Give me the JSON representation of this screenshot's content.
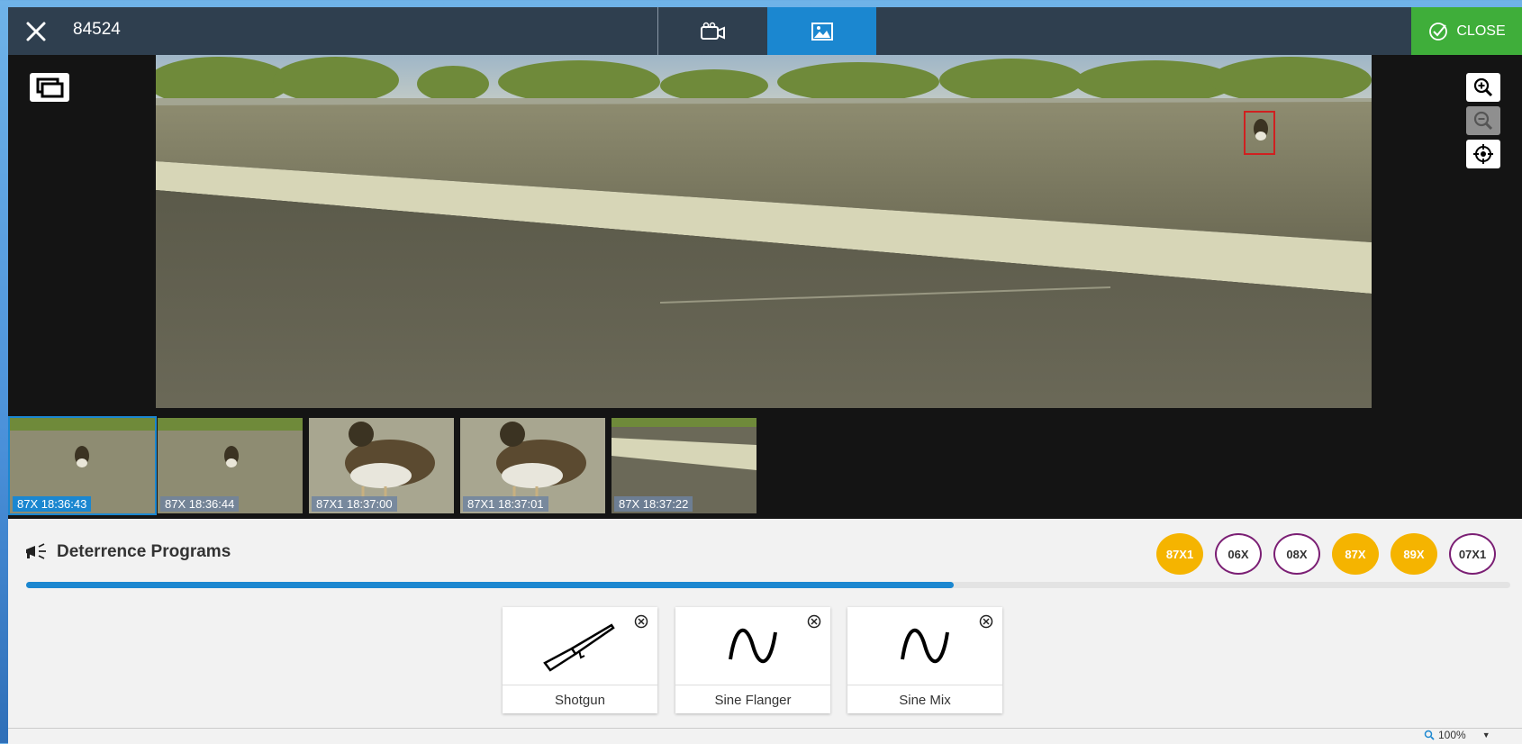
{
  "header": {
    "record_id": "84524",
    "tabs": [
      {
        "name": "video",
        "icon": "video-camera-icon",
        "active": false
      },
      {
        "name": "image",
        "icon": "image-icon",
        "active": true
      }
    ],
    "close_label": "CLOSE"
  },
  "viewer": {
    "tools": [
      "zoom-in-icon",
      "zoom-out-icon",
      "target-icon"
    ],
    "zoom_out_disabled": true
  },
  "thumbnails": [
    {
      "label": "87X 18:36:43",
      "selected": true
    },
    {
      "label": "87X 18:36:44",
      "selected": false
    },
    {
      "label": "87X1 18:37:00",
      "selected": false
    },
    {
      "label": "87X1 18:37:01",
      "selected": false
    },
    {
      "label": "87X 18:37:22",
      "selected": false
    }
  ],
  "deterrence": {
    "title": "Deterrence Programs",
    "progress": 0.625,
    "chips": [
      {
        "label": "87X1",
        "style": "filled"
      },
      {
        "label": "06X",
        "style": "outlined"
      },
      {
        "label": "08X",
        "style": "outlined"
      },
      {
        "label": "87X",
        "style": "filled"
      },
      {
        "label": "89X",
        "style": "filled"
      },
      {
        "label": "07X1",
        "style": "outlined"
      }
    ],
    "programs": [
      {
        "label": "Shotgun",
        "icon": "shotgun-icon"
      },
      {
        "label": "Sine Flanger",
        "icon": "sine-wave-icon"
      },
      {
        "label": "Sine Mix",
        "icon": "sine-wave-icon"
      }
    ]
  },
  "status": {
    "zoom": "100%"
  },
  "colors": {
    "accent": "#1b87d0",
    "close": "#3fae3a",
    "chip_filled": "#f5b400",
    "chip_outline": "#7b1f74"
  }
}
